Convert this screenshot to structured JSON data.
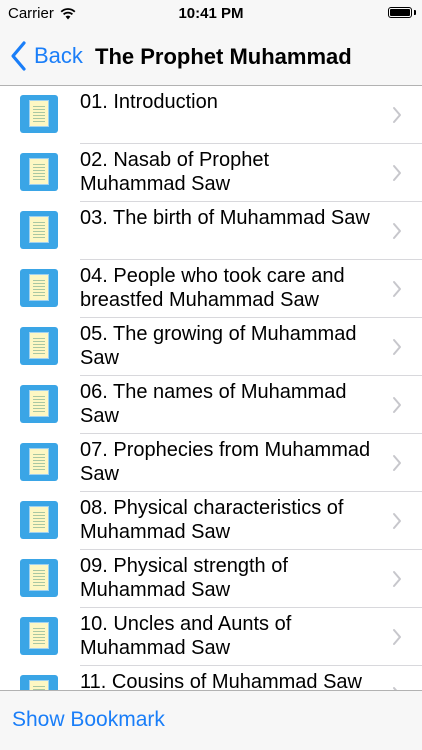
{
  "status_bar": {
    "carrier": "Carrier",
    "time": "10:41 PM"
  },
  "nav": {
    "back_label": "Back",
    "title": "The Prophet Muhammad"
  },
  "list": {
    "items": [
      {
        "label": "01. Introduction"
      },
      {
        "label": "02. Nasab of Prophet Muhammad Saw"
      },
      {
        "label": "03. The birth of Muhammad Saw"
      },
      {
        "label": "04. People who took care and breastfed Muhammad Saw"
      },
      {
        "label": "05. The growing of Muhammad Saw"
      },
      {
        "label": "06. The names of Muhammad Saw"
      },
      {
        "label": "07. Prophecies from Muhammad Saw"
      },
      {
        "label": "08. Physical characteristics of Muhammad Saw"
      },
      {
        "label": "09. Physical strength of Muhammad Saw"
      },
      {
        "label": "10. Uncles and Aunts of Muhammad Saw"
      },
      {
        "label": "11. Cousins of Muhammad Saw"
      }
    ]
  },
  "toolbar": {
    "bookmark_label": "Show Bookmark"
  },
  "colors": {
    "accent": "#1a7ef8",
    "icon_bg": "#3aa5e6"
  },
  "icons": {
    "wifi": "wifi-icon",
    "battery": "battery-icon",
    "back": "chevron-left-icon",
    "row": "document-icon",
    "disclosure": "chevron-right-icon"
  }
}
